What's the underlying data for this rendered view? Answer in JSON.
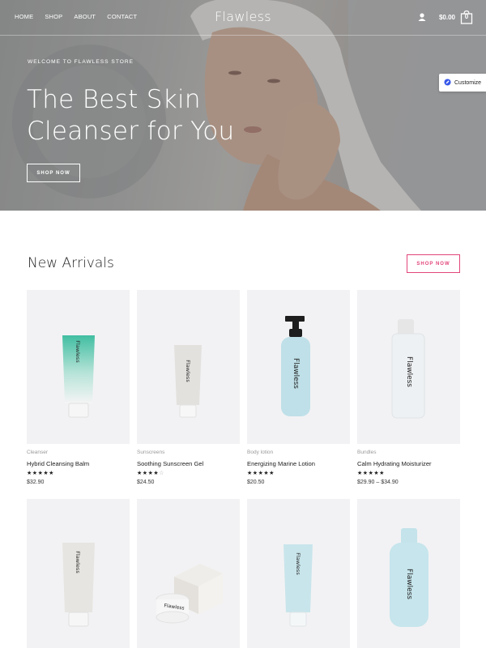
{
  "nav": {
    "links": [
      "HOME",
      "SHOP",
      "ABOUT",
      "CONTACT"
    ],
    "brand": "Flawless",
    "cart_total": "$0.00",
    "cart_count": "0"
  },
  "hero": {
    "eyebrow": "WELCOME TO FLAWLESS STORE",
    "title_line1": "The Best Skin",
    "title_line2": "Cleanser for You",
    "button": "SHOP NOW"
  },
  "customize": {
    "label": "Customize"
  },
  "arrivals": {
    "title": "New Arrivals",
    "button": "SHOP NOW",
    "products": [
      {
        "category": "Cleanser",
        "name": "Hybrid Cleansing Balm",
        "rating": 5,
        "price": "$32.90",
        "label": "Flawless"
      },
      {
        "category": "Sunscreens",
        "name": "Soothing Sunscreen Gel",
        "rating": 4,
        "price": "$24.50",
        "label": "Flawless"
      },
      {
        "category": "Body lotion",
        "name": "Energizing Marine Lotion",
        "rating": 5,
        "price": "$20.50",
        "label": "Flawless"
      },
      {
        "category": "Bundles",
        "name": "Calm Hydrating Moisturizer",
        "rating": 5,
        "price": "$29.90 – $34.90",
        "label": "Flawless"
      },
      {
        "label": "Flawless"
      },
      {
        "label": "Flawless"
      },
      {
        "label": "Flawless"
      },
      {
        "label": "Flawless"
      }
    ]
  },
  "colors": {
    "accent": "#e2457a",
    "card_bg": "#f2f2f4"
  }
}
